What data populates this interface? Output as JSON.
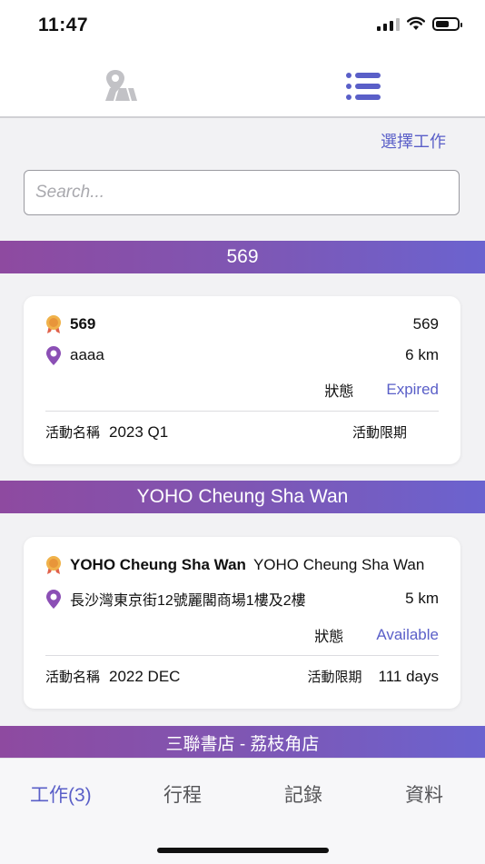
{
  "status_bar": {
    "time": "11:47"
  },
  "top_tabs": [
    {
      "name": "map",
      "icon": "map-location-icon",
      "active": false
    },
    {
      "name": "list",
      "icon": "list-icon",
      "active": true
    }
  ],
  "header": {
    "select_job_label": "選擇工作"
  },
  "search": {
    "placeholder": "Search..."
  },
  "groups": [
    {
      "header": "569",
      "card": {
        "name": "569",
        "subname": "",
        "code": "569",
        "address": "aaaa",
        "distance": "6 km",
        "status_label": "狀態",
        "status_value": "Expired",
        "campaign_label": "活動名稱",
        "campaign_value": "2023 Q1",
        "deadline_label": "活動限期",
        "deadline_value": ""
      }
    },
    {
      "header": "YOHO Cheung Sha Wan",
      "card": {
        "name": "YOHO Cheung Sha Wan",
        "subname": "YOHO Cheung Sha Wan",
        "code": "",
        "address": "長沙灣東京街12號麗閣商場1樓及2樓",
        "distance": "5 km",
        "status_label": "狀態",
        "status_value": "Available",
        "campaign_label": "活動名稱",
        "campaign_value": "2022 DEC",
        "deadline_label": "活動限期",
        "deadline_value": "111 days"
      }
    },
    {
      "header": "三聯書店 - 荔枝角店"
    }
  ],
  "bottom_nav": [
    {
      "label": "工作(3)",
      "active": true
    },
    {
      "label": "行程",
      "active": false
    },
    {
      "label": "記錄",
      "active": false
    },
    {
      "label": "資料",
      "active": false
    }
  ],
  "colors": {
    "accent": "#5a5fc8",
    "header_gradient_start": "#8e4aa0",
    "header_gradient_end": "#6b63cf"
  }
}
